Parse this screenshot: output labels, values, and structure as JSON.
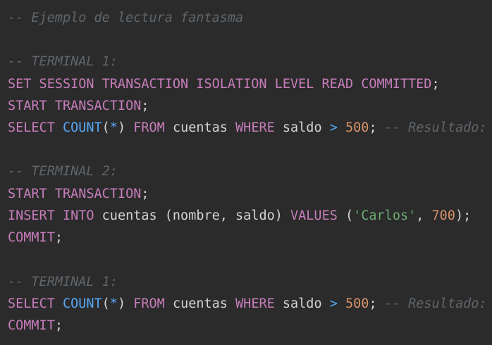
{
  "editor": {
    "lines": [
      {
        "comment": "-- Ejemplo de lectura fantasma"
      },
      {},
      {
        "comment": "-- TERMINAL 1:"
      },
      {
        "kw": "SET SESSION TRANSACTION ISOLATION LEVEL READ COMMITTED",
        "punct": ";"
      },
      {
        "kw": "START TRANSACTION",
        "punct": ";"
      },
      {
        "kw1": "SELECT",
        "fn": "COUNT",
        "p1": "(",
        "star": "*",
        "p2": ")",
        "kw2": "FROM",
        "ident": "cuentas",
        "kw3": "WHERE",
        "col": "saldo",
        "op": ">",
        "num": "500",
        "punct": ";",
        "comment": "-- Resultado:"
      },
      {},
      {
        "comment": "-- TERMINAL 2:"
      },
      {
        "kw": "START TRANSACTION",
        "punct": ";"
      },
      {
        "kw1": "INSERT INTO",
        "ident": "cuentas",
        "p1": "(",
        "col1": "nombre",
        "comma1": ",",
        "col2": "saldo",
        "p2": ")",
        "kw2": "VALUES",
        "p3": "(",
        "str": "'Carlos'",
        "comma2": ",",
        "num": "700",
        "p4": ")",
        "punct": ";"
      },
      {
        "kw": "COMMIT",
        "punct": ";"
      },
      {},
      {
        "comment": "-- TERMINAL 1:"
      },
      {
        "kw1": "SELECT",
        "fn": "COUNT",
        "p1": "(",
        "star": "*",
        "p2": ")",
        "kw2": "FROM",
        "ident": "cuentas",
        "kw3": "WHERE",
        "col": "saldo",
        "op": ">",
        "num": "500",
        "punct": ";",
        "comment": "-- Resultado:"
      },
      {
        "kw": "COMMIT",
        "punct": ";"
      }
    ]
  },
  "colors": {
    "background": "#2b2b2b",
    "keyword": "#c77dbb",
    "function": "#56a8f5",
    "number": "#d5926a",
    "string": "#6aab73",
    "comment": "#5f656b",
    "text": "#d4d4d4"
  }
}
